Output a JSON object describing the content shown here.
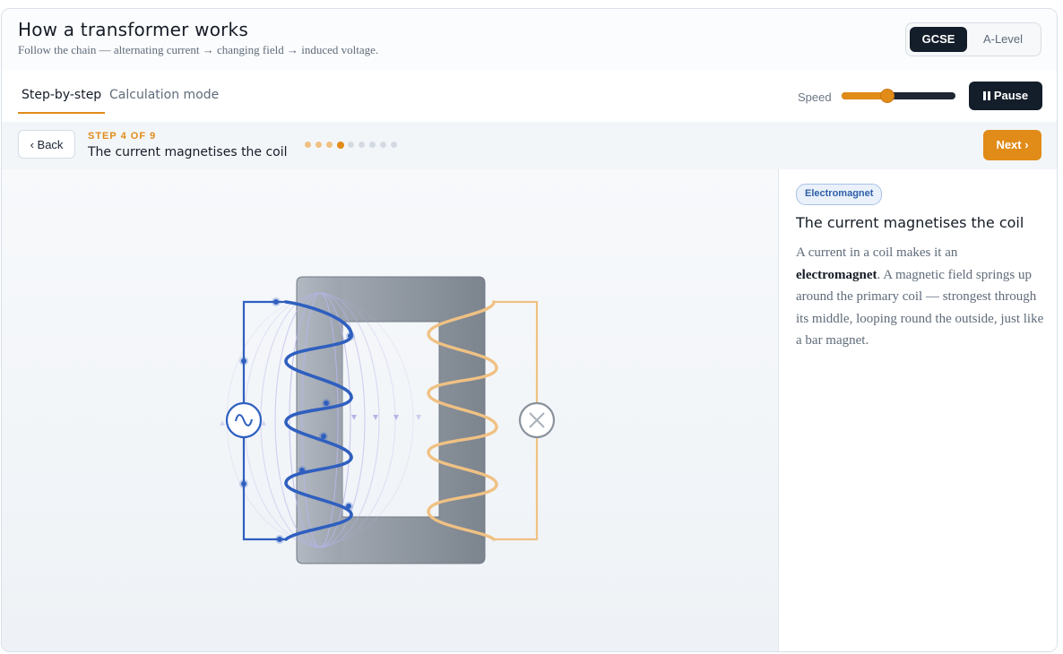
{
  "header": {
    "title": "How a transformer works",
    "subtitle": "Follow the chain — alternating current → changing field → induced voltage.",
    "levels": [
      {
        "label": "GCSE",
        "active": true
      },
      {
        "label": "A-Level",
        "active": false
      }
    ]
  },
  "tabs": [
    {
      "label": "Step-by-step",
      "active": true
    },
    {
      "label": "Calculation mode",
      "active": false
    }
  ],
  "speed": {
    "label": "Speed",
    "value": 0.4
  },
  "pause_label": "Pause",
  "step": {
    "back_label": "‹ Back",
    "kicker": "STEP 4 OF 9",
    "title": "The current magnetises the coil",
    "current": 4,
    "total": 9,
    "next_label": "Next ›"
  },
  "panel": {
    "badge": "Electromagnet",
    "title": "The current magnetises the coil",
    "body_pre": "A current in a coil makes it an ",
    "body_bold": "electromagnet",
    "body_post": ". A magnetic field springs up around the primary coil — strongest through its middle, looping round the outside, just like a bar magnet."
  },
  "colors": {
    "accent": "#e18b19",
    "dark": "#141d2a",
    "primary_coil": "#2f5fbf",
    "secondary_coil": "#f0c183",
    "field_lines": "#b7b4e8",
    "core": "#8c949e"
  },
  "icons": {
    "ac_source": "ac-source-icon",
    "lamp": "lamp-icon"
  }
}
